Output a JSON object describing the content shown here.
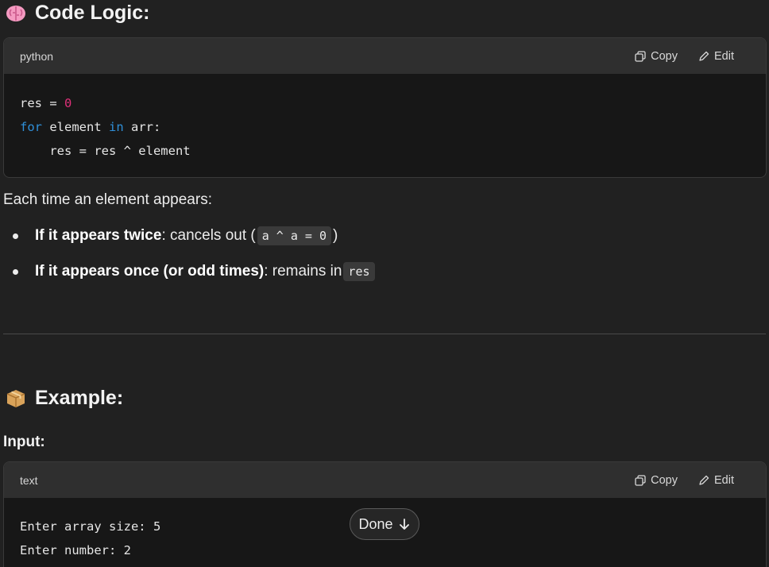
{
  "section1": {
    "title": "Code Logic:",
    "icon": "brain-icon"
  },
  "code1": {
    "language": "python",
    "copy_label": "Copy",
    "edit_label": "Edit",
    "lines": {
      "l1a": "res = ",
      "l1b": "0",
      "l2a": "for",
      "l2b": " element ",
      "l2c": "in",
      "l2d": " arr:",
      "l3": "    res = res ^ element"
    }
  },
  "explanation": {
    "intro": "Each time an element appears:",
    "bullets": [
      {
        "bold": "If it appears twice",
        "text": ": cancels out (",
        "code": "a ^ a = 0",
        "tail": ")"
      },
      {
        "bold": "If it appears once (or odd times)",
        "text": ": remains in ",
        "code": "res",
        "tail": ""
      }
    ]
  },
  "section2": {
    "title": "Example:",
    "icon": "package-icon"
  },
  "input_label": "Input:",
  "code2": {
    "language": "text",
    "copy_label": "Copy",
    "edit_label": "Edit",
    "lines": [
      "Enter array size: 5",
      "Enter number: 2"
    ]
  },
  "done_button": {
    "label": "Done",
    "icon": "arrow-down-icon"
  },
  "colors": {
    "background": "#212121",
    "code_keyword": "#2f8fd8",
    "code_number": "#df3079"
  }
}
